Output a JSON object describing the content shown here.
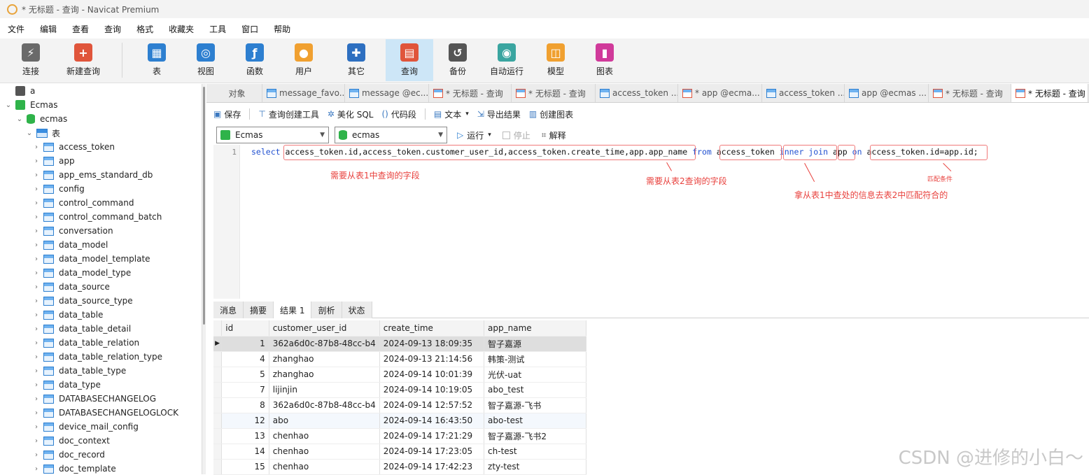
{
  "window": {
    "title": "* 无标题 - 查询 - Navicat Premium"
  },
  "menu": [
    "文件",
    "编辑",
    "查看",
    "查询",
    "格式",
    "收藏夹",
    "工具",
    "窗口",
    "帮助"
  ],
  "toolbar": [
    {
      "label": "连接",
      "icon": "plug-icon",
      "color": "#6a6a6a"
    },
    {
      "label": "新建查询",
      "icon": "new-query-icon",
      "color": "#e0553b"
    },
    {
      "label": "表",
      "icon": "table-icon",
      "color": "#2d7fd0"
    },
    {
      "label": "视图",
      "icon": "view-icon",
      "color": "#2d7fd0"
    },
    {
      "label": "函数",
      "icon": "function-icon",
      "color": "#2d7fd0"
    },
    {
      "label": "用户",
      "icon": "user-icon",
      "color": "#f0a030"
    },
    {
      "label": "其它",
      "icon": "tools-icon",
      "color": "#2d6fc0"
    },
    {
      "label": "查询",
      "icon": "query-icon",
      "color": "#e0553b"
    },
    {
      "label": "备份",
      "icon": "backup-icon",
      "color": "#555555"
    },
    {
      "label": "自动运行",
      "icon": "robot-icon",
      "color": "#3aa5a0"
    },
    {
      "label": "模型",
      "icon": "model-icon",
      "color": "#f0a030"
    },
    {
      "label": "图表",
      "icon": "chart-icon",
      "color": "#d03a9a"
    }
  ],
  "tree": {
    "conn_a": "a",
    "conn_ecmas": "Ecmas",
    "db": "ecmas",
    "group": "表",
    "tables": [
      "access_token",
      "app",
      "app_ems_standard_db",
      "config",
      "control_command",
      "control_command_batch",
      "conversation",
      "data_model",
      "data_model_template",
      "data_model_type",
      "data_source",
      "data_source_type",
      "data_table",
      "data_table_detail",
      "data_table_relation",
      "data_table_relation_type",
      "data_table_type",
      "data_type",
      "DATABASECHANGELOG",
      "DATABASECHANGELOGLOCK",
      "device_mail_config",
      "doc_context",
      "doc_record",
      "doc_template"
    ]
  },
  "tabs": [
    {
      "label": "对象",
      "kind": "obj"
    },
    {
      "label": "message_favo...",
      "kind": "t"
    },
    {
      "label": "message @ec...",
      "kind": "t"
    },
    {
      "label": "* 无标题 - 查询",
      "kind": "q"
    },
    {
      "label": "* 无标题 - 查询",
      "kind": "q"
    },
    {
      "label": "access_token ...",
      "kind": "t"
    },
    {
      "label": "* app @ecma...",
      "kind": "q"
    },
    {
      "label": "access_token ...",
      "kind": "t"
    },
    {
      "label": "app @ecmas ...",
      "kind": "t"
    },
    {
      "label": "* 无标题 - 查询",
      "kind": "q"
    },
    {
      "label": "* 无标题 - 查询",
      "kind": "q"
    }
  ],
  "editbar": {
    "save": "保存",
    "builder": "查询创建工具",
    "beautify": "美化 SQL",
    "snippet": "代码段",
    "text": "文本",
    "export": "导出结果",
    "chart": "创建图表"
  },
  "selectors": {
    "connection": "Ecmas",
    "database": "ecmas",
    "run": "运行",
    "stop": "停止",
    "explain": "解释"
  },
  "sql": {
    "line": "1",
    "select": "select",
    "fields": "access_token.id,access_token.customer_user_id,access_token.create_time,app.app_name",
    "from": "from",
    "table1": "access_token",
    "inner_join": "inner join",
    "table2": "app",
    "on": "on",
    "condition": "access_token.id=app.id;"
  },
  "annotations": {
    "a1": "需要从表1中查询的字段",
    "a2": "需要从表2查询的字段",
    "a3": "拿从表1中查处的信息去表2中匹配符合的",
    "a4": "匹配条件"
  },
  "result_tabs": [
    "消息",
    "摘要",
    "结果 1",
    "剖析",
    "状态"
  ],
  "grid": {
    "columns": [
      "id",
      "customer_user_id",
      "create_time",
      "app_name"
    ],
    "rows": [
      [
        "1",
        "362a6d0c-87b8-48cc-b4",
        "2024-09-13 18:09:35",
        "智子嘉源"
      ],
      [
        "4",
        "zhanghao",
        "2024-09-13 21:14:56",
        "韩策-测试"
      ],
      [
        "5",
        "zhanghao",
        "2024-09-14 10:01:39",
        "光伏-uat"
      ],
      [
        "7",
        "lijinjin",
        "2024-09-14 10:19:05",
        "abo_test"
      ],
      [
        "8",
        "362a6d0c-87b8-48cc-b4",
        "2024-09-14 12:57:52",
        "智子嘉源-飞书"
      ],
      [
        "12",
        "abo",
        "2024-09-14 16:43:50",
        "abo-test"
      ],
      [
        "13",
        "chenhao",
        "2024-09-14 17:21:29",
        "智子嘉源-飞书2"
      ],
      [
        "14",
        "chenhao",
        "2024-09-14 17:23:05",
        "ch-test"
      ],
      [
        "15",
        "chenhao",
        "2024-09-14 17:42:23",
        "zty-test"
      ]
    ]
  },
  "watermark": "CSDN @进修的小白～"
}
